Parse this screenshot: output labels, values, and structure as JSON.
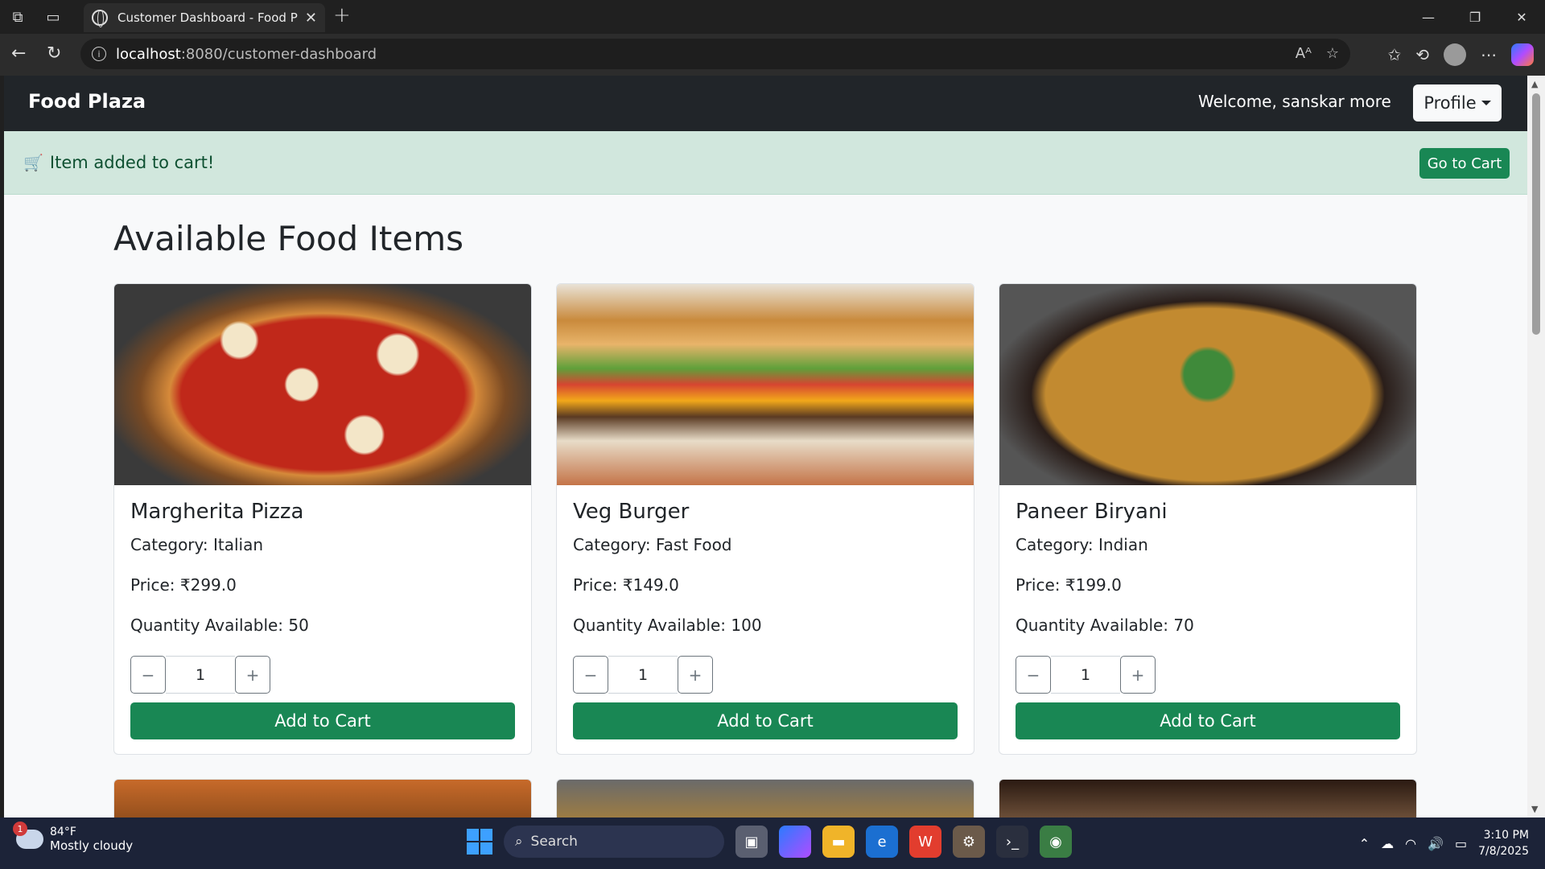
{
  "browser": {
    "tab_title": "Customer Dashboard - Food Plaza",
    "url_host": "localhost",
    "url_path": ":8080/customer-dashboard"
  },
  "navbar": {
    "brand": "Food Plaza",
    "welcome": "Welcome, sanskar more",
    "profile_label": "Profile"
  },
  "alert": {
    "message": "Item added to cart!",
    "button_label": "Go to Cart"
  },
  "page": {
    "heading": "Available Food Items"
  },
  "items": [
    {
      "name": "Margherita Pizza",
      "category": "Category: Italian",
      "price": "Price: ₹299.0",
      "quantity": "Quantity Available: 50",
      "selected_qty": "1",
      "button": "Add to Cart"
    },
    {
      "name": "Veg Burger",
      "category": "Category: Fast Food",
      "price": "Price: ₹149.0",
      "quantity": "Quantity Available: 100",
      "selected_qty": "1",
      "button": "Add to Cart"
    },
    {
      "name": "Paneer Biryani",
      "category": "Category: Indian",
      "price": "Price: ₹199.0",
      "quantity": "Quantity Available: 70",
      "selected_qty": "1",
      "button": "Add to Cart"
    }
  ],
  "stepper": {
    "minus": "−",
    "plus": "+"
  },
  "taskbar": {
    "temperature": "84°F",
    "weather": "Mostly cloudy",
    "weather_badge": "1",
    "search": "Search",
    "time": "3:10 PM",
    "date": "7/8/2025"
  },
  "colors": {
    "navbar_bg": "#212529",
    "alert_bg": "#d1e7dd",
    "success": "#198754"
  }
}
